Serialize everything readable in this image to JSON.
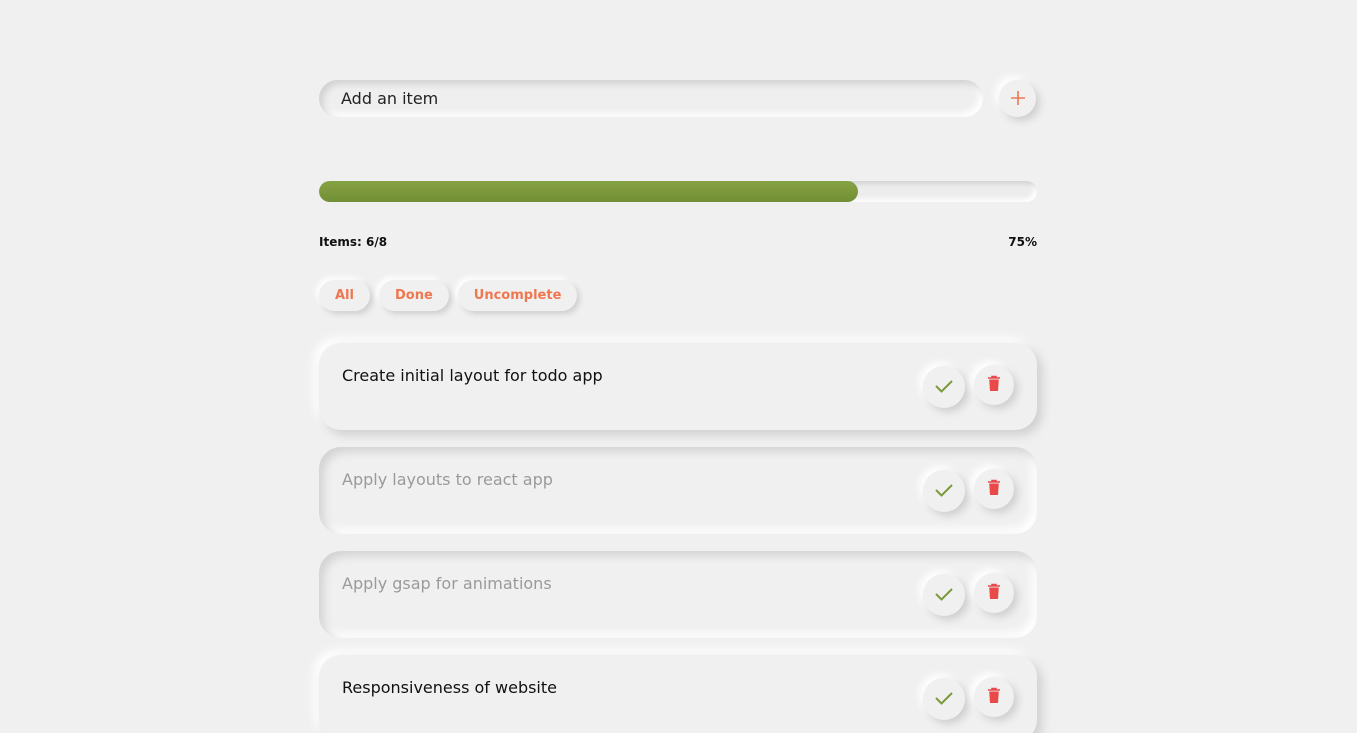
{
  "add_item": {
    "placeholder": "Add an item",
    "button_icon": "plus-icon"
  },
  "progress": {
    "fraction": 0.75,
    "items_label": "Items: 6/8",
    "percent_label": "75%",
    "color": "#7a9a3c"
  },
  "filters": [
    {
      "label": "All"
    },
    {
      "label": "Done"
    },
    {
      "label": "Uncomplete"
    }
  ],
  "colors": {
    "accent": "#ef7750",
    "check": "#7a9a3c",
    "delete": "#e84a4a",
    "done_text": "#9a9a9a"
  },
  "todos": [
    {
      "text": "Create initial layout for todo app",
      "done": false
    },
    {
      "text": "Apply layouts to react app",
      "done": true
    },
    {
      "text": "Apply gsap for animations",
      "done": true
    },
    {
      "text": "Responsiveness of website",
      "done": false
    }
  ]
}
